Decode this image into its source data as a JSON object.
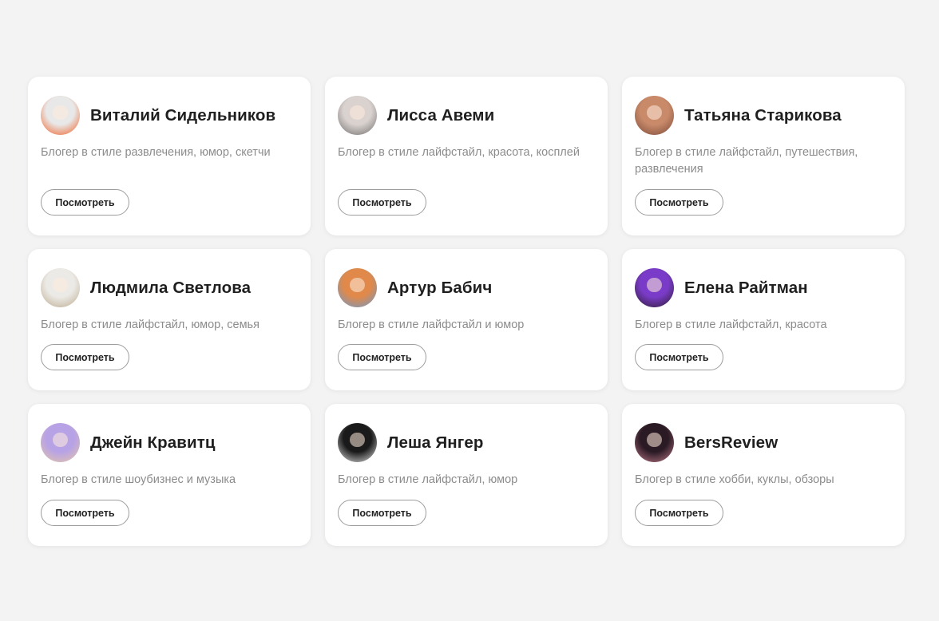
{
  "cards": [
    {
      "name": "Виталий Сидельников",
      "description": "Блогер в стиле развлечения, юмор, скетчи",
      "button": "Посмотреть",
      "avatar_colors": [
        "#e8e8e8",
        "#f05a1e"
      ]
    },
    {
      "name": "Лисса Авеми",
      "description": "Блогер в стиле лайфстайл, красота, косплей",
      "button": "Посмотреть",
      "avatar_colors": [
        "#d9d2cf",
        "#6e6a6a"
      ]
    },
    {
      "name": "Татьяна Старикова",
      "description": "Блогер в стиле лайфстайл, путешествия, развлечения",
      "button": "Посмотреть",
      "avatar_colors": [
        "#c98a6a",
        "#7a4a3a"
      ]
    },
    {
      "name": "Людмила Светлова",
      "description": "Блогер в стиле лайфстайл, юмор, семья",
      "button": "Посмотреть",
      "avatar_colors": [
        "#eceae6",
        "#b9a88c"
      ]
    },
    {
      "name": "Артур Бабич",
      "description": "Блогер в стиле лайфстайл и юмор",
      "button": "Посмотреть",
      "avatar_colors": [
        "#e0894a",
        "#6a9ad0"
      ]
    },
    {
      "name": "Елена Райтман",
      "description": "Блогер в стиле лайфстайл, красота",
      "button": "Посмотреть",
      "avatar_colors": [
        "#7a3cc8",
        "#2a1a2a"
      ]
    },
    {
      "name": "Джейн Кравитц",
      "description": "Блогер в стиле шоубизнес и музыка",
      "button": "Посмотреть",
      "avatar_colors": [
        "#b7a2e6",
        "#e6c7a5"
      ]
    },
    {
      "name": "Леша Янгер",
      "description": "Блогер в стиле лайфстайл, юмор",
      "button": "Посмотреть",
      "avatar_colors": [
        "#1a1a1a",
        "#e8e8e8"
      ]
    },
    {
      "name": "BersReview",
      "description": "Блогер в стиле хобби, куклы, обзоры",
      "button": "Посмотреть",
      "avatar_colors": [
        "#2a1a24",
        "#c07a8a"
      ]
    }
  ]
}
